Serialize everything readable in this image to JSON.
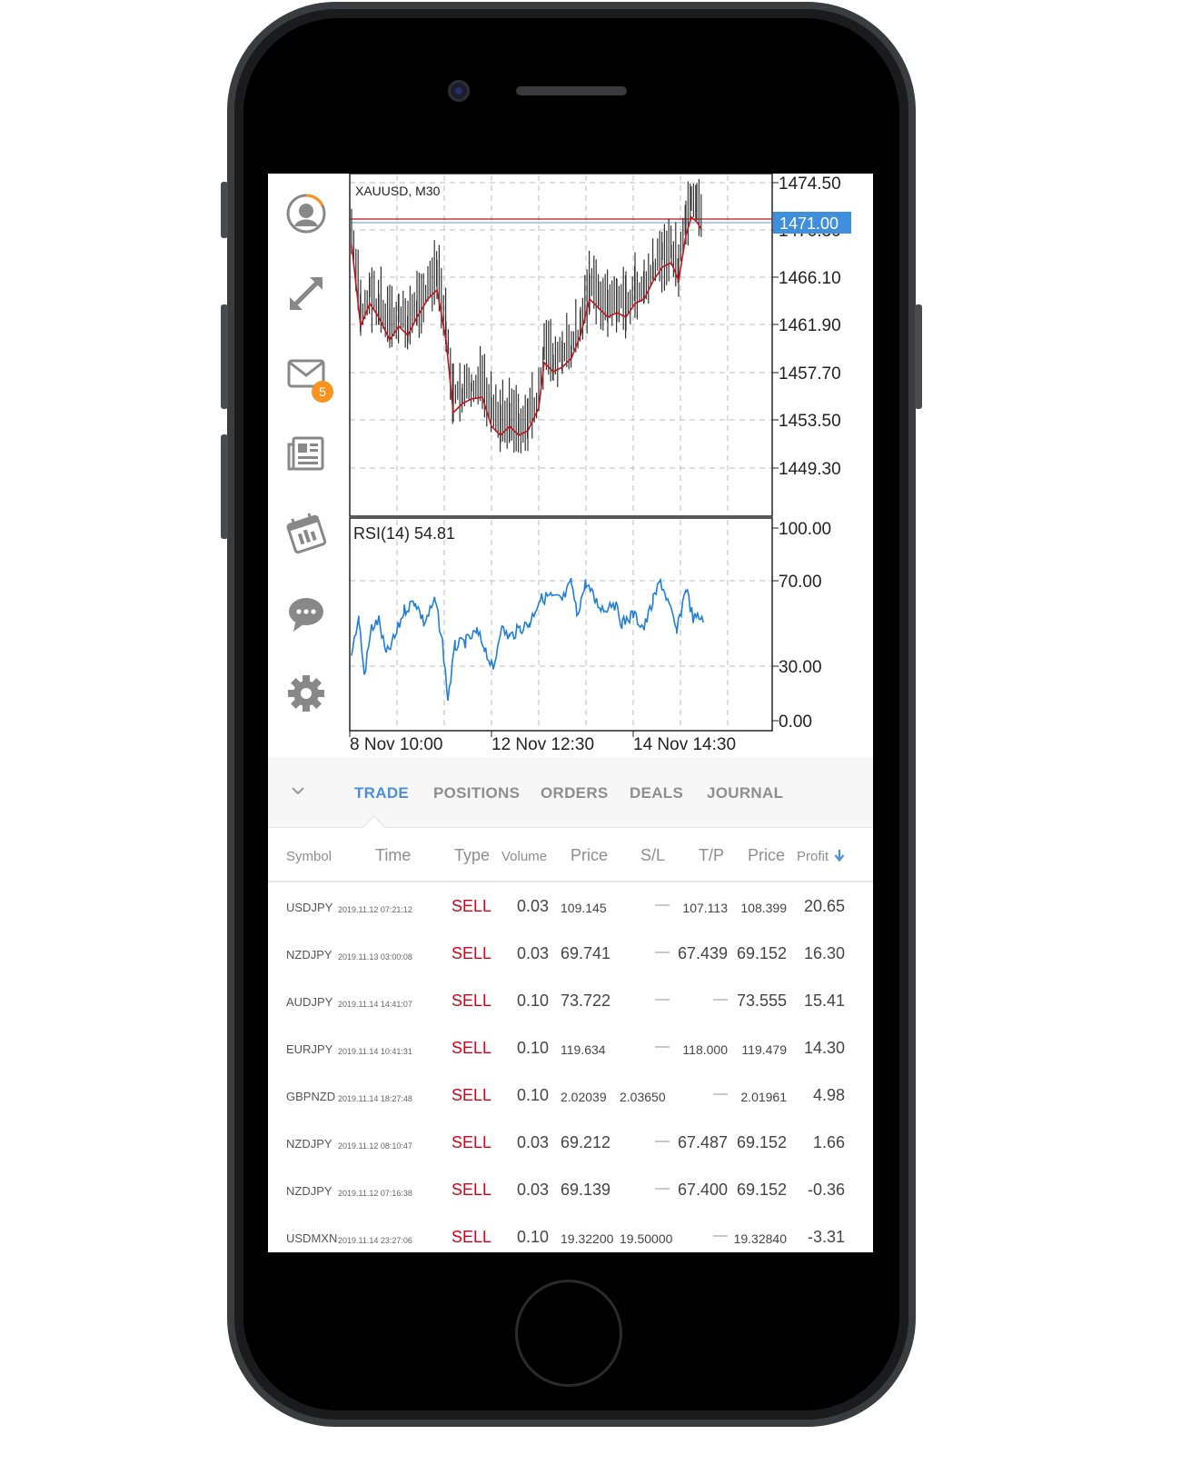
{
  "chart": {
    "symbol_label": "XAUUSD, M30",
    "indicator_label": "RSI(14) 54.81",
    "current_price": "1471.00",
    "price_levels": [
      "1474.50",
      "1470.30",
      "1466.10",
      "1461.90",
      "1457.70",
      "1453.50",
      "1449.30"
    ],
    "rsi_levels": [
      "100.00",
      "70.00",
      "30.00",
      "0.00"
    ],
    "time_labels": [
      "8 Nov 10:00",
      "12 Nov 12:30",
      "14 Nov 14:30"
    ],
    "colors": {
      "ma": "#c0141b",
      "rsi": "#1f7fd6",
      "current_price_bg": "#3f8fdc",
      "candles": "#333333"
    }
  },
  "sidebar": {
    "icons": [
      "account-icon",
      "trade-arrows-icon",
      "mail-icon",
      "news-icon",
      "calendar-icon",
      "chat-icon",
      "settings-icon"
    ],
    "mail_badge": "5"
  },
  "tabs": [
    {
      "label": "TRADE",
      "active": true
    },
    {
      "label": "POSITIONS",
      "active": false
    },
    {
      "label": "ORDERS",
      "active": false
    },
    {
      "label": "DEALS",
      "active": false
    },
    {
      "label": "JOURNAL",
      "active": false
    }
  ],
  "table": {
    "headers": {
      "symbol": "Symbol",
      "time": "Time",
      "type": "Type",
      "volume": "Volume",
      "price": "Price",
      "sl": "S/L",
      "tp": "T/P",
      "current_price": "Price",
      "profit": "Profit"
    },
    "rows": [
      {
        "symbol": "USDJPY",
        "time": "2019.11.12 07:21:12",
        "type": "SELL",
        "volume": "0.03",
        "price": "109.145",
        "sl": "—",
        "tp": "107.113",
        "current_price": "108.399",
        "profit": "20.65"
      },
      {
        "symbol": "NZDJPY",
        "time": "2019.11.13 03:00:08",
        "type": "SELL",
        "volume": "0.03",
        "price": "69.741",
        "sl": "—",
        "tp": "67.439",
        "current_price": "69.152",
        "profit": "16.30"
      },
      {
        "symbol": "AUDJPY",
        "time": "2019.11.14 14:41:07",
        "type": "SELL",
        "volume": "0.10",
        "price": "73.722",
        "sl": "—",
        "tp": "—",
        "current_price": "73.555",
        "profit": "15.41"
      },
      {
        "symbol": "EURJPY",
        "time": "2019.11.14 10:41:31",
        "type": "SELL",
        "volume": "0.10",
        "price": "119.634",
        "sl": "—",
        "tp": "118.000",
        "current_price": "119.479",
        "profit": "14.30"
      },
      {
        "symbol": "GBPNZD",
        "time": "2019.11.14 18:27:48",
        "type": "SELL",
        "volume": "0.10",
        "price": "2.02039",
        "sl": "2.03650",
        "tp": "—",
        "current_price": "2.01961",
        "profit": "4.98"
      },
      {
        "symbol": "NZDJPY",
        "time": "2019.11.12 08:10:47",
        "type": "SELL",
        "volume": "0.03",
        "price": "69.212",
        "sl": "—",
        "tp": "67.487",
        "current_price": "69.152",
        "profit": "1.66"
      },
      {
        "symbol": "NZDJPY",
        "time": "2019.11.12 07:16:38",
        "type": "SELL",
        "volume": "0.03",
        "price": "69.139",
        "sl": "—",
        "tp": "67.400",
        "current_price": "69.152",
        "profit": "-0.36"
      },
      {
        "symbol": "USDMXN",
        "time": "2019.11.14 23:27:06",
        "type": "SELL",
        "volume": "0.10",
        "price": "19.32200",
        "sl": "19.50000",
        "tp": "—",
        "current_price": "19.32840",
        "profit": "-3.31"
      }
    ]
  }
}
